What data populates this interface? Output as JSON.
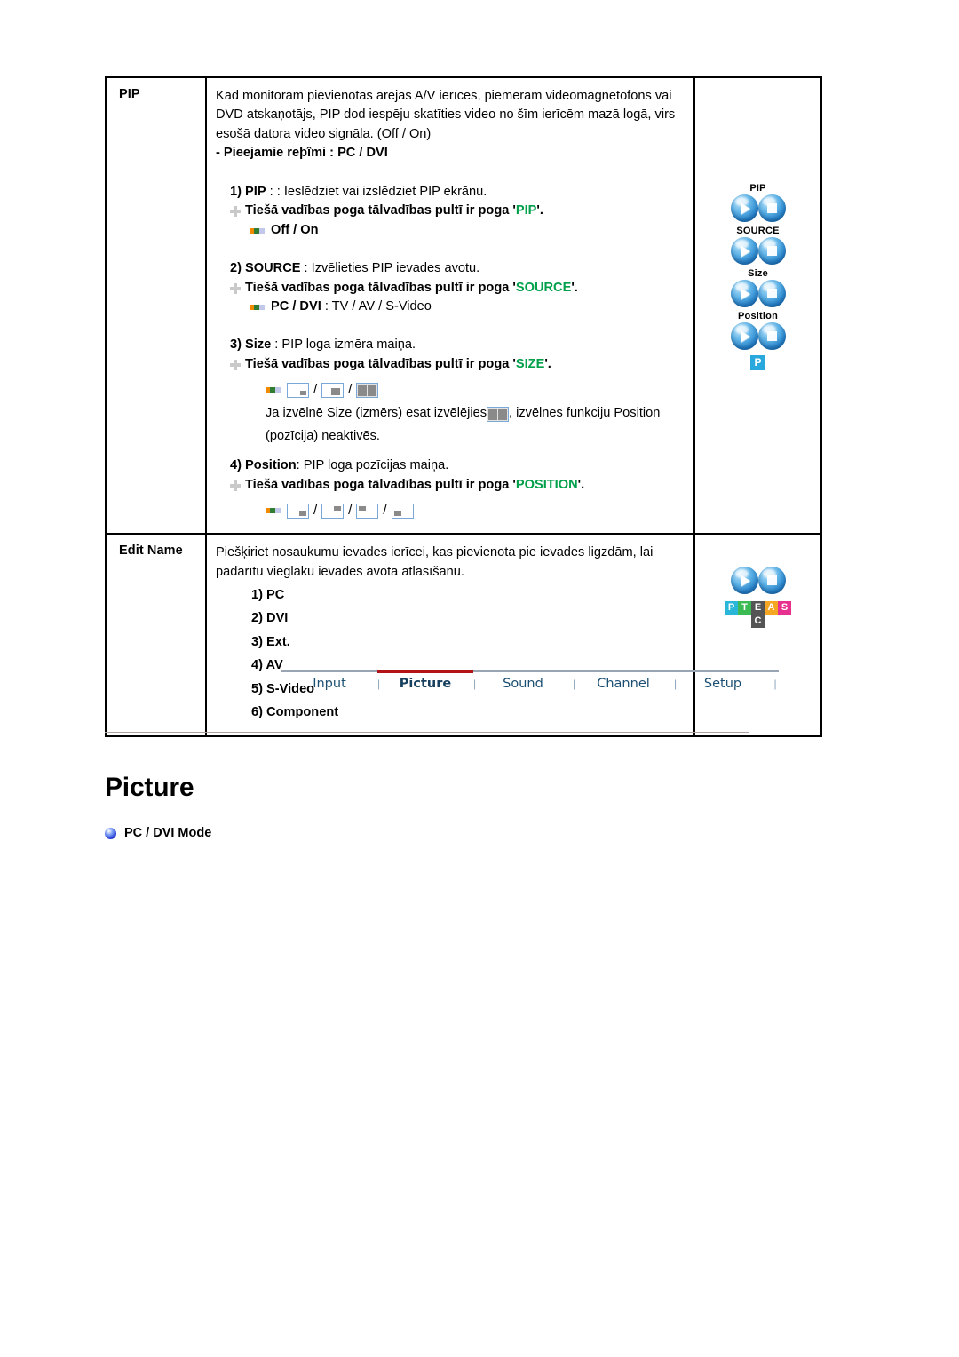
{
  "table": {
    "rows": [
      {
        "name": "PIP",
        "intro": "Kad monitoram pievienotas ārējas A/V ierīces, piemēram videomagnetofons vai DVD atskaņotājs, PIP dod iespēju skatīties video no šīm ierīcēm mazā logā, virs esošā datora video signāla. (Off / On)",
        "modes_line": "- Pieejamie reþîmi : PC / DVI",
        "items": [
          {
            "num": "1)",
            "term": "PIP",
            "desc": " : : Ieslēdziet vai izslēdziet PIP ekrānu.",
            "direct_prefix": "Tiešā vadības poga tālvadības pultī ir poga '",
            "direct_key": "PIP",
            "direct_suffix": "'.",
            "options": "Off / On"
          },
          {
            "num": "2)",
            "term": "SOURCE",
            "desc": " : Izvēlieties PIP ievades avotu.",
            "direct_prefix": "Tiešā vadības poga tālvadības pultī ir poga '",
            "direct_key": "SOURCE",
            "direct_suffix": "'.",
            "options_bold": "PC / DVI",
            "options_rest": " : TV / AV / S-Video"
          },
          {
            "num": "3)",
            "term": "Size",
            "desc": " : PIP loga izmēra maiņa.",
            "direct_prefix": "Tiešā vadības poga tālvadības pultī ir poga '",
            "direct_key": "SIZE",
            "direct_suffix": "'.",
            "note_before": "Ja izvēlnē Size (izmērs) esat izvēlējies ",
            "note_after": " , izvēlnes funkciju Position",
            "note_line2": "(pozīcija) neaktivēs."
          },
          {
            "num": "4)",
            "term": "Position",
            "desc": ": PIP loga pozīcijas maiņa.",
            "direct_prefix": "Tiešā vadības poga tālvadības pultī ir poga '",
            "direct_key": "POSITION",
            "direct_suffix": "'."
          }
        ],
        "remote": {
          "labels": [
            "PIP",
            "SOURCE",
            "Size",
            "Position"
          ],
          "chip": "P"
        }
      },
      {
        "name": "Edit Name",
        "intro": "Piešķiriet nosaukumu ievades ierīcei, kas pievienota pie ievades ligzdām, lai padarītu vieglāku ievades avota atlasīšanu.",
        "list": [
          "1) PC",
          "2) DVI",
          "3) Ext.",
          "4) AV",
          "5) S-Video",
          "6) Component"
        ],
        "tiles_row1": [
          {
            "letter": "P",
            "color": "#29b6d8"
          },
          {
            "letter": "T",
            "color": "#3cba54"
          },
          {
            "letter": "E",
            "color": "#555555"
          },
          {
            "letter": "A",
            "color": "#f5a623"
          },
          {
            "letter": "S",
            "color": "#e8318f"
          }
        ],
        "tiles_row2": [
          {
            "letter": "C",
            "color": "#555555"
          }
        ]
      }
    ]
  },
  "nav": {
    "items": [
      {
        "label": "Input",
        "active": false
      },
      {
        "label": "Picture",
        "active": true
      },
      {
        "label": "Sound",
        "active": false
      },
      {
        "label": "Channel",
        "active": false
      },
      {
        "label": "Setup",
        "active": false
      }
    ],
    "separator": "|",
    "active_color": "#b31217",
    "text_color": "#1b4f72"
  },
  "page": {
    "title": "Picture",
    "section": "PC / DVI Mode"
  }
}
